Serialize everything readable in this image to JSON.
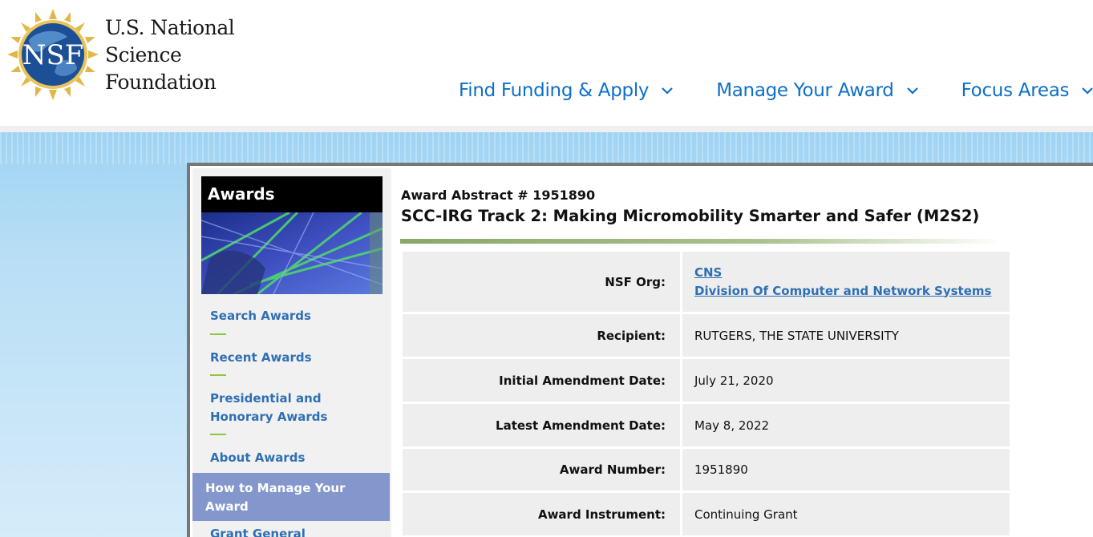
{
  "header": {
    "logo": {
      "seal_text": "NSF",
      "line1": "U.S. National",
      "line2": "Science",
      "line3": "Foundation"
    },
    "nav": [
      {
        "label": "Find Funding & Apply"
      },
      {
        "label": "Manage Your Award"
      },
      {
        "label": "Focus Areas"
      }
    ]
  },
  "sidebar": {
    "banner_title": "Awards",
    "links": [
      {
        "label": "Search Awards"
      },
      {
        "label": "Recent Awards"
      },
      {
        "label_line1": "Presidential and",
        "label_line2": "Honorary Awards"
      },
      {
        "label": "About Awards"
      }
    ],
    "active": {
      "label_line1": "How to Manage Your",
      "label_line2": "Award"
    },
    "next": {
      "label": "Grant General"
    }
  },
  "award": {
    "abstract_label": "Award Abstract # 1951890",
    "title": "SCC-IRG Track 2: Making Micromobility Smarter and Safer (M2S2)",
    "details": {
      "nsf_org": {
        "label": "NSF Org:",
        "code": "CNS",
        "name": "Division Of Computer and Network Systems"
      },
      "recipient": {
        "label": "Recipient:",
        "value": "RUTGERS, THE STATE UNIVERSITY"
      },
      "initial_amendment": {
        "label": "Initial Amendment Date:",
        "value": "July 21, 2020"
      },
      "latest_amendment": {
        "label": "Latest Amendment Date:",
        "value": "May 8, 2022"
      },
      "award_number": {
        "label": "Award Number:",
        "value": "1951890"
      },
      "award_instrument": {
        "label": "Award Instrument:",
        "value": "Continuing Grant"
      }
    }
  },
  "colors": {
    "nav_blue": "#0f6fc6",
    "link_blue": "#2f6fb3",
    "accent_green": "#8dc63f",
    "active_bg": "#8497cc"
  }
}
